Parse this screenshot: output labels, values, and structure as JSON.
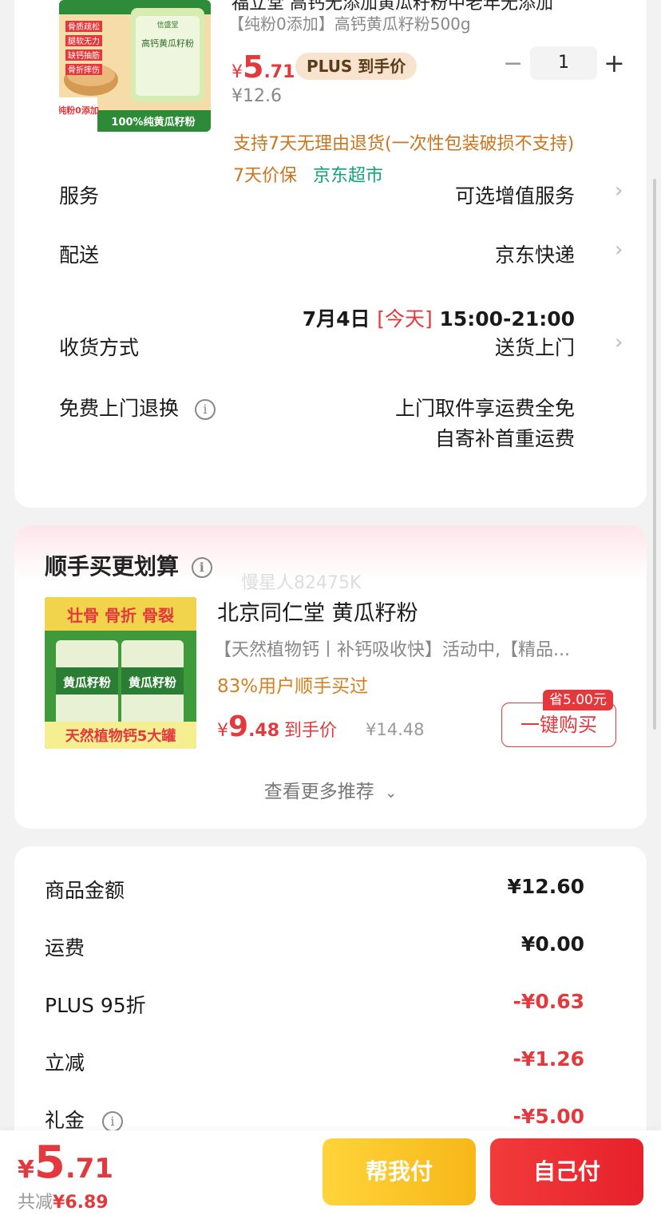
{
  "product": {
    "title_fragment": "福立堂 高钙无添加黄瓜籽粉中老年无添加",
    "subtitle": "【纯粉0添加】高钙黄瓜籽粉500g",
    "price_yen": "¥",
    "price_int": "5",
    "price_dec": ".71",
    "plus_label": "PLUS 到手价",
    "original_price": "¥12.6",
    "quantity": "1",
    "minus_symbol": "−",
    "plus_symbol": "+",
    "returns_note": "支持7天无理由退货(一次性包装破损不支持)",
    "tag_price_protect": "7天价保",
    "tag_store": "京东超市",
    "image_text": {
      "side_labels": [
        "骨质疏松",
        "腿软无力",
        "缺钙抽筋",
        "骨折摔伤"
      ],
      "can_brand": "信盛堂",
      "can_name": "高钙黄瓜籽粉",
      "badge": "纯粉0添加",
      "banner": "100%纯黄瓜籽粉"
    }
  },
  "service": {
    "label": "服务",
    "value": "可选增值服务"
  },
  "delivery": {
    "label": "配送",
    "value": "京东快递",
    "date": "7月4日",
    "today": "[今天]",
    "window": "15:00-21:00"
  },
  "receive": {
    "label": "收货方式",
    "value": "送货上门"
  },
  "free_return": {
    "label": "免费上门退换",
    "line1": "上门取件享运费全免",
    "line2": "自寄补首重运费"
  },
  "recommend": {
    "section_title": "顺手买更划算",
    "watermark": "慢星人82475K",
    "item_title": "北京同仁堂 黄瓜籽粉",
    "item_desc": "【天然植物钙丨补钙吸收快】活动中,【精品...",
    "bought_text": "83%用户顺手买过",
    "price_yen": "¥",
    "price_int": "9",
    "price_dec": ".48",
    "price_suffix": "到手价",
    "original_price": "¥14.48",
    "save_badge": "省5.00元",
    "buy_button": "一键购买",
    "see_more": "查看更多推荐",
    "image_text": {
      "top_banner": "壮骨 骨折 骨裂",
      "can_name": "黄瓜籽粉",
      "bottom_banner": "天然植物钙5大罐"
    }
  },
  "summary": {
    "rows": [
      {
        "label": "商品金额",
        "value": "¥12.60",
        "negative": false
      },
      {
        "label": "运费",
        "value": "¥0.00",
        "negative": false
      },
      {
        "label": "PLUS 95折",
        "value": "-¥0.63",
        "negative": true
      },
      {
        "label": "立减",
        "value": "-¥1.26",
        "negative": true
      },
      {
        "label": "礼金",
        "value": "-¥5.00",
        "negative": true
      }
    ]
  },
  "bottom": {
    "total_yen": "¥",
    "total_int": "5",
    "total_dec": ".71",
    "saved_label": "共减",
    "saved_amount": "¥6.89",
    "help_pay": "帮我付",
    "self_pay": "自己付"
  },
  "colors": {
    "accent_red": "#e4393c",
    "jd_green": "#13a577",
    "orange_text": "#c9741f",
    "pay_yellow": "#f7b718"
  }
}
